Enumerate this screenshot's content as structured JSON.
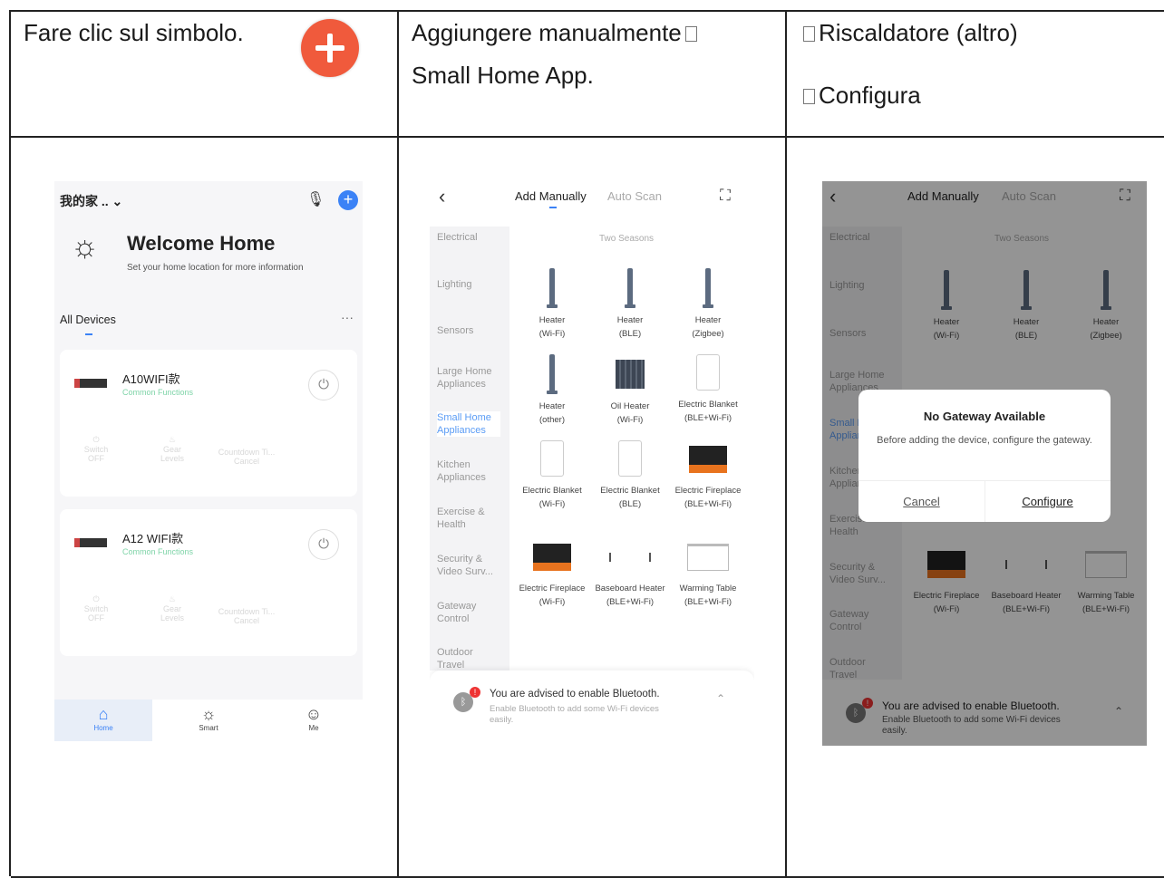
{
  "row1": {
    "c1": "Fare clic sul simbolo.",
    "c2_line1": "Aggiungere manualmente",
    "c2_line2": "Small Home App.",
    "c3_line1": "Riscaldatore (altro)",
    "c3_line2": "Configura"
  },
  "phone1": {
    "home_name": "我的家 ..",
    "welcome": "Welcome Home",
    "location_hint": "Set your home location for more information",
    "all_devices": "All Devices",
    "devices": [
      {
        "name": "A10WIFI款",
        "sub": "Common Functions"
      },
      {
        "name": "A12 WIFI款",
        "sub": "Common Functions"
      }
    ],
    "controls": [
      {
        "label": "Switch",
        "state": "OFF"
      },
      {
        "label": "Gear",
        "state": "Levels"
      },
      {
        "label": "Countdown Ti...",
        "state": "Cancel"
      }
    ],
    "nav": [
      "Home",
      "Smart",
      "Me"
    ],
    "accent": "#3b82f6"
  },
  "phone2": {
    "tab_manual": "Add Manually",
    "tab_scan": "Auto Scan",
    "section": "Two Seasons",
    "categories": [
      "Electrical",
      "Lighting",
      "Sensors",
      "Large Home Appliances",
      "Small Home Appliances",
      "Kitchen Appliances",
      "Exercise & Health",
      "Security & Video Surv...",
      "Gateway Control",
      "Outdoor Travel"
    ],
    "items": [
      {
        "name": "Heater",
        "sub": "(Wi-Fi)"
      },
      {
        "name": "Heater",
        "sub": "(BLE)"
      },
      {
        "name": "Heater",
        "sub": "(Zigbee)"
      },
      {
        "name": "Heater",
        "sub": "(other)"
      },
      {
        "name": "Oil Heater",
        "sub": "(Wi-Fi)"
      },
      {
        "name": "Electric Blanket",
        "sub": "(BLE+Wi-Fi)"
      },
      {
        "name": "Electric Blanket",
        "sub": "(Wi-Fi)"
      },
      {
        "name": "Electric Blanket",
        "sub": "(BLE)"
      },
      {
        "name": "Electric Fireplace",
        "sub": "(BLE+Wi-Fi)"
      },
      {
        "name": "Electric Fireplace",
        "sub": "(Wi-Fi)"
      },
      {
        "name": "Baseboard Heater",
        "sub": "(BLE+Wi-Fi)"
      },
      {
        "name": "Warming Table",
        "sub": "(BLE+Wi-Fi)"
      }
    ],
    "bt_title": "You are advised to enable Bluetooth.",
    "bt_sub": "Enable Bluetooth to add some Wi-Fi devices easily."
  },
  "phone3": {
    "dialog_title": "No Gateway Available",
    "dialog_text": "Before adding the device, configure the gateway.",
    "cancel": "Cancel",
    "configure": "Configure"
  }
}
